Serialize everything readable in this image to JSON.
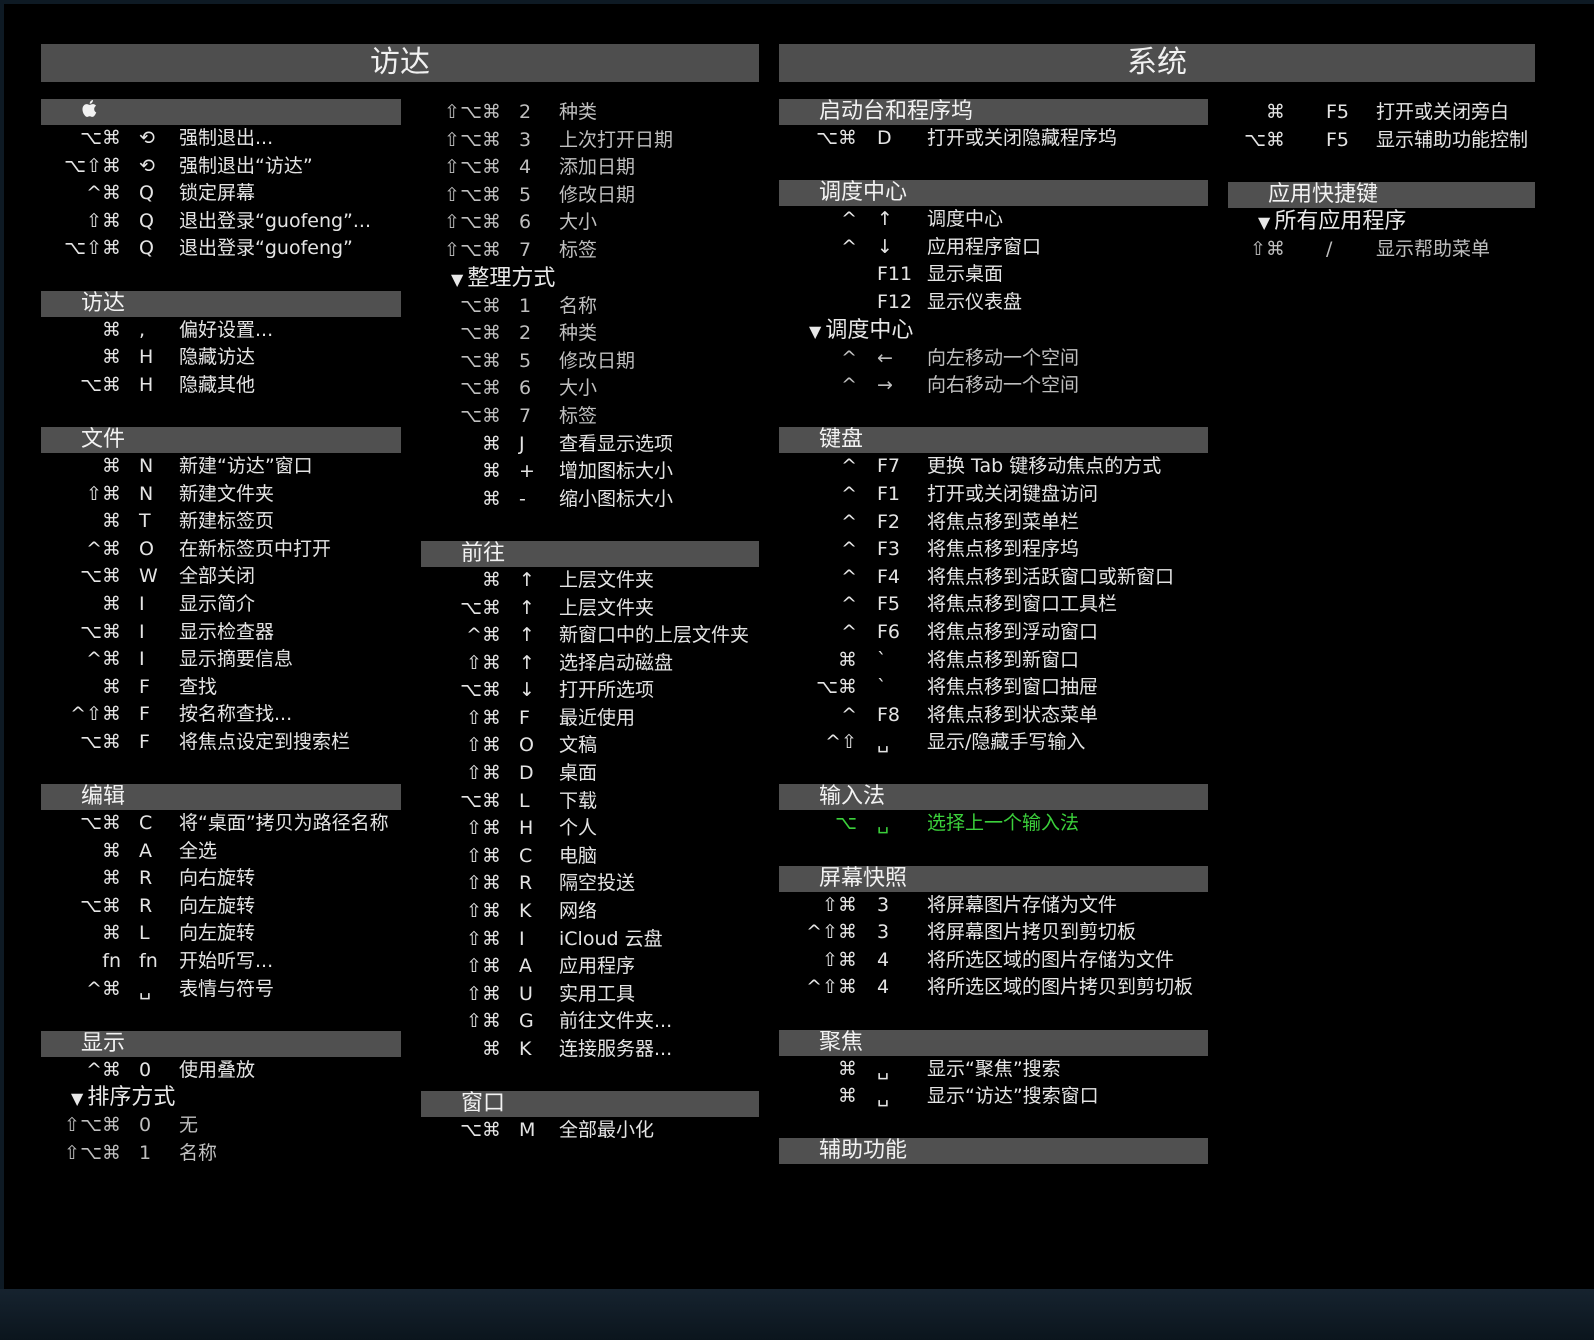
{
  "headers": {
    "finder": "访达",
    "system": "系统"
  },
  "col1": [
    {
      "t": "h",
      "label": "",
      "apple": true
    },
    {
      "t": "r",
      "m": "⌥⌘",
      "k": "⟲",
      "a": "强制退出..."
    },
    {
      "t": "r",
      "m": "⌥⇧⌘",
      "k": "⟲",
      "a": "强制退出“访达”"
    },
    {
      "t": "r",
      "m": "^⌘",
      "k": "Q",
      "a": "锁定屏幕"
    },
    {
      "t": "r",
      "m": "⇧⌘",
      "k": "Q",
      "a": "退出登录“guofeng”..."
    },
    {
      "t": "r",
      "m": "⌥⇧⌘",
      "k": "Q",
      "a": "退出登录“guofeng”"
    },
    {
      "t": "g"
    },
    {
      "t": "h",
      "label": "访达"
    },
    {
      "t": "r",
      "m": "⌘",
      "k": ",",
      "a": "偏好设置..."
    },
    {
      "t": "r",
      "m": "⌘",
      "k": "H",
      "a": "隐藏访达"
    },
    {
      "t": "r",
      "m": "⌥⌘",
      "k": "H",
      "a": "隐藏其他"
    },
    {
      "t": "g"
    },
    {
      "t": "h",
      "label": "文件"
    },
    {
      "t": "r",
      "m": "⌘",
      "k": "N",
      "a": "新建“访达”窗口"
    },
    {
      "t": "r",
      "m": "⇧⌘",
      "k": "N",
      "a": "新建文件夹"
    },
    {
      "t": "r",
      "m": "⌘",
      "k": "T",
      "a": "新建标签页"
    },
    {
      "t": "r",
      "m": "^⌘",
      "k": "O",
      "a": "在新标签页中打开"
    },
    {
      "t": "r",
      "m": "⌥⌘",
      "k": "W",
      "a": "全部关闭"
    },
    {
      "t": "r",
      "m": "⌘",
      "k": "I",
      "a": "显示简介"
    },
    {
      "t": "r",
      "m": "⌥⌘",
      "k": "I",
      "a": "显示检查器"
    },
    {
      "t": "r",
      "m": "^⌘",
      "k": "I",
      "a": "显示摘要信息"
    },
    {
      "t": "r",
      "m": "⌘",
      "k": "F",
      "a": "查找"
    },
    {
      "t": "r",
      "m": "^⇧⌘",
      "k": "F",
      "a": "按名称查找..."
    },
    {
      "t": "r",
      "m": "⌥⌘",
      "k": "F",
      "a": "将焦点设定到搜索栏"
    },
    {
      "t": "g"
    },
    {
      "t": "h",
      "label": "编辑"
    },
    {
      "t": "r",
      "m": "⌥⌘",
      "k": "C",
      "a": "将“桌面”拷贝为路径名称"
    },
    {
      "t": "r",
      "m": "⌘",
      "k": "A",
      "a": "全选"
    },
    {
      "t": "r",
      "m": "⌘",
      "k": "R",
      "a": "向右旋转"
    },
    {
      "t": "r",
      "m": "⌥⌘",
      "k": "R",
      "a": "向左旋转"
    },
    {
      "t": "r",
      "m": "⌘",
      "k": "L",
      "a": "向左旋转"
    },
    {
      "t": "r",
      "m": "fn",
      "k": "fn",
      "a": "开始听写..."
    },
    {
      "t": "r",
      "m": "^⌘",
      "k": "␣",
      "a": "表情与符号"
    },
    {
      "t": "g"
    },
    {
      "t": "h",
      "label": "显示"
    },
    {
      "t": "r",
      "m": "^⌘",
      "k": "0",
      "a": "使用叠放"
    },
    {
      "t": "s",
      "label": "排序方式"
    },
    {
      "t": "r",
      "m": "⇧⌥⌘",
      "k": "0",
      "a": "无",
      "dim": true
    },
    {
      "t": "r",
      "m": "⇧⌥⌘",
      "k": "1",
      "a": "名称",
      "dim": true
    }
  ],
  "col2": [
    {
      "t": "r",
      "m": "⇧⌥⌘",
      "k": "2",
      "a": "种类",
      "dim": true
    },
    {
      "t": "r",
      "m": "⇧⌥⌘",
      "k": "3",
      "a": "上次打开日期",
      "dim": true
    },
    {
      "t": "r",
      "m": "⇧⌥⌘",
      "k": "4",
      "a": "添加日期",
      "dim": true
    },
    {
      "t": "r",
      "m": "⇧⌥⌘",
      "k": "5",
      "a": "修改日期",
      "dim": true
    },
    {
      "t": "r",
      "m": "⇧⌥⌘",
      "k": "6",
      "a": "大小",
      "dim": true
    },
    {
      "t": "r",
      "m": "⇧⌥⌘",
      "k": "7",
      "a": "标签",
      "dim": true
    },
    {
      "t": "s",
      "label": "整理方式"
    },
    {
      "t": "r",
      "m": "⌥⌘",
      "k": "1",
      "a": "名称",
      "dim": true
    },
    {
      "t": "r",
      "m": "⌥⌘",
      "k": "2",
      "a": "种类",
      "dim": true
    },
    {
      "t": "r",
      "m": "⌥⌘",
      "k": "5",
      "a": "修改日期",
      "dim": true
    },
    {
      "t": "r",
      "m": "⌥⌘",
      "k": "6",
      "a": "大小",
      "dim": true
    },
    {
      "t": "r",
      "m": "⌥⌘",
      "k": "7",
      "a": "标签",
      "dim": true
    },
    {
      "t": "r",
      "m": "⌘",
      "k": "J",
      "a": "查看显示选项"
    },
    {
      "t": "r",
      "m": "⌘",
      "k": "+",
      "a": "增加图标大小"
    },
    {
      "t": "r",
      "m": "⌘",
      "k": "-",
      "a": "缩小图标大小"
    },
    {
      "t": "g"
    },
    {
      "t": "h",
      "label": "前往"
    },
    {
      "t": "r",
      "m": "⌘",
      "k": "↑",
      "a": "上层文件夹"
    },
    {
      "t": "r",
      "m": "⌥⌘",
      "k": "↑",
      "a": "上层文件夹"
    },
    {
      "t": "r",
      "m": "^⌘",
      "k": "↑",
      "a": "新窗口中的上层文件夹"
    },
    {
      "t": "r",
      "m": "⇧⌘",
      "k": "↑",
      "a": "选择启动磁盘"
    },
    {
      "t": "r",
      "m": "⌥⌘",
      "k": "↓",
      "a": "打开所选项"
    },
    {
      "t": "r",
      "m": "⇧⌘",
      "k": "F",
      "a": "最近使用"
    },
    {
      "t": "r",
      "m": "⇧⌘",
      "k": "O",
      "a": "文稿"
    },
    {
      "t": "r",
      "m": "⇧⌘",
      "k": "D",
      "a": "桌面"
    },
    {
      "t": "r",
      "m": "⌥⌘",
      "k": "L",
      "a": "下载"
    },
    {
      "t": "r",
      "m": "⇧⌘",
      "k": "H",
      "a": "个人"
    },
    {
      "t": "r",
      "m": "⇧⌘",
      "k": "C",
      "a": "电脑"
    },
    {
      "t": "r",
      "m": "⇧⌘",
      "k": "R",
      "a": "隔空投送"
    },
    {
      "t": "r",
      "m": "⇧⌘",
      "k": "K",
      "a": "网络"
    },
    {
      "t": "r",
      "m": "⇧⌘",
      "k": "I",
      "a": "iCloud 云盘"
    },
    {
      "t": "r",
      "m": "⇧⌘",
      "k": "A",
      "a": "应用程序"
    },
    {
      "t": "r",
      "m": "⇧⌘",
      "k": "U",
      "a": "实用工具"
    },
    {
      "t": "r",
      "m": "⇧⌘",
      "k": "G",
      "a": "前往文件夹..."
    },
    {
      "t": "r",
      "m": "⌘",
      "k": "K",
      "a": "连接服务器..."
    },
    {
      "t": "g"
    },
    {
      "t": "h",
      "label": "窗口"
    },
    {
      "t": "r",
      "m": "⌥⌘",
      "k": "M",
      "a": "全部最小化"
    }
  ],
  "col3": [
    {
      "t": "h",
      "label": "启动台和程序坞"
    },
    {
      "t": "r",
      "m": "⌥⌘",
      "k": "D",
      "a": "打开或关闭隐藏程序坞"
    },
    {
      "t": "g"
    },
    {
      "t": "h",
      "label": "调度中心"
    },
    {
      "t": "r",
      "m": "^",
      "k": "↑",
      "a": "调度中心"
    },
    {
      "t": "r",
      "m": "^",
      "k": "↓",
      "a": "应用程序窗口"
    },
    {
      "t": "r",
      "m": "",
      "k": "F11",
      "a": "显示桌面"
    },
    {
      "t": "r",
      "m": "",
      "k": "F12",
      "a": "显示仪表盘"
    },
    {
      "t": "s",
      "label": "调度中心"
    },
    {
      "t": "r",
      "m": "^",
      "k": "←",
      "a": "向左移动一个空间",
      "dim": true
    },
    {
      "t": "r",
      "m": "^",
      "k": "→",
      "a": "向右移动一个空间",
      "dim": true
    },
    {
      "t": "g"
    },
    {
      "t": "h",
      "label": "键盘"
    },
    {
      "t": "r",
      "m": "^",
      "k": "F7",
      "a": "更换 Tab 键移动焦点的方式"
    },
    {
      "t": "r",
      "m": "^",
      "k": "F1",
      "a": "打开或关闭键盘访问"
    },
    {
      "t": "r",
      "m": "^",
      "k": "F2",
      "a": "将焦点移到菜单栏"
    },
    {
      "t": "r",
      "m": "^",
      "k": "F3",
      "a": "将焦点移到程序坞"
    },
    {
      "t": "r",
      "m": "^",
      "k": "F4",
      "a": "将焦点移到活跃窗口或新窗口"
    },
    {
      "t": "r",
      "m": "^",
      "k": "F5",
      "a": "将焦点移到窗口工具栏"
    },
    {
      "t": "r",
      "m": "^",
      "k": "F6",
      "a": "将焦点移到浮动窗口"
    },
    {
      "t": "r",
      "m": "⌘",
      "k": "`",
      "a": "将焦点移到新窗口"
    },
    {
      "t": "r",
      "m": "⌥⌘",
      "k": "`",
      "a": "将焦点移到窗口抽屉"
    },
    {
      "t": "r",
      "m": "^",
      "k": "F8",
      "a": "将焦点移到状态菜单"
    },
    {
      "t": "r",
      "m": "^⇧",
      "k": "␣",
      "a": "显示/隐藏手写输入"
    },
    {
      "t": "g"
    },
    {
      "t": "h",
      "label": "输入法"
    },
    {
      "t": "r",
      "m": "⌥",
      "k": "␣",
      "a": "选择上一个输入法",
      "hl": true
    },
    {
      "t": "g"
    },
    {
      "t": "h",
      "label": "屏幕快照"
    },
    {
      "t": "r",
      "m": "⇧⌘",
      "k": "3",
      "a": "将屏幕图片存储为文件"
    },
    {
      "t": "r",
      "m": "^⇧⌘",
      "k": "3",
      "a": "将屏幕图片拷贝到剪切板"
    },
    {
      "t": "r",
      "m": "⇧⌘",
      "k": "4",
      "a": "将所选区域的图片存储为文件"
    },
    {
      "t": "r",
      "m": "^⇧⌘",
      "k": "4",
      "a": "将所选区域的图片拷贝到剪切板"
    },
    {
      "t": "g"
    },
    {
      "t": "h",
      "label": "聚焦"
    },
    {
      "t": "r",
      "m": "⌘",
      "k": "␣",
      "a": "显示“聚焦”搜索"
    },
    {
      "t": "r",
      "m": "⌘",
      "k": "␣",
      "a": "显示“访达”搜索窗口"
    },
    {
      "t": "g"
    },
    {
      "t": "h",
      "label": "辅助功能"
    }
  ],
  "col4": [
    {
      "t": "r",
      "m": "⌘",
      "k": "F5",
      "a": "打开或关闭旁白"
    },
    {
      "t": "r",
      "m": "⌥⌘",
      "k": "F5",
      "a": "显示辅助功能控制"
    },
    {
      "t": "g"
    },
    {
      "t": "h",
      "label": "应用快捷键"
    },
    {
      "t": "s",
      "label": "所有应用程序"
    },
    {
      "t": "r",
      "m": "⇧⌘",
      "k": "/",
      "a": "显示帮助菜单",
      "dim": true
    }
  ]
}
